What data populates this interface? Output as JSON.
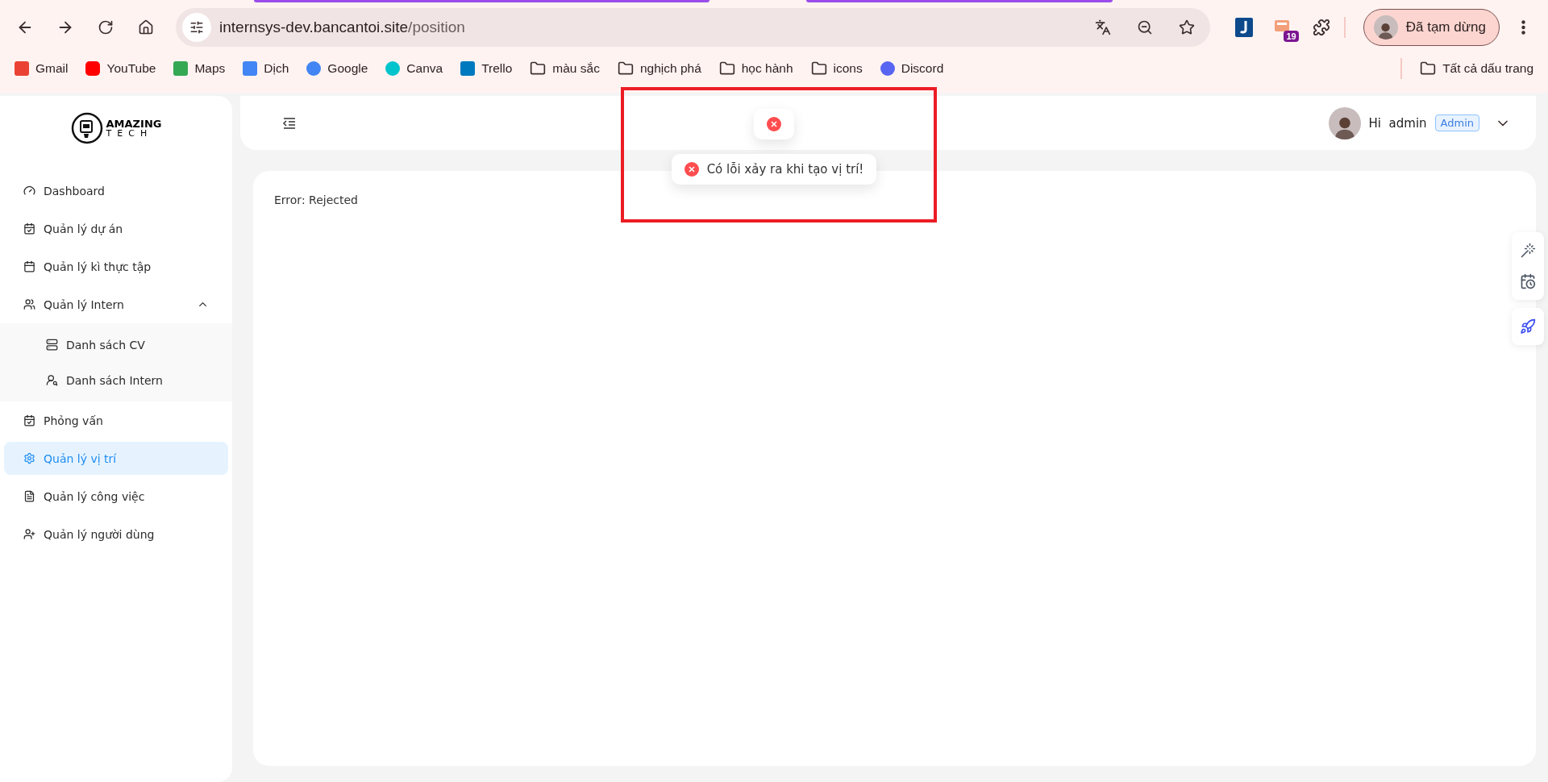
{
  "browser": {
    "url_host": "internsys-dev.bancantoi.site",
    "url_path": "/position",
    "extension_badge": "19",
    "profile_label": "Đã tạm dừng",
    "bookmarks": [
      {
        "kind": "site",
        "label": "Gmail"
      },
      {
        "kind": "site",
        "label": "YouTube"
      },
      {
        "kind": "site",
        "label": "Maps"
      },
      {
        "kind": "site",
        "label": "Dịch"
      },
      {
        "kind": "site",
        "label": "Google"
      },
      {
        "kind": "site",
        "label": "Canva"
      },
      {
        "kind": "site",
        "label": "Trello"
      },
      {
        "kind": "folder",
        "label": "màu sắc"
      },
      {
        "kind": "folder",
        "label": "nghịch phá"
      },
      {
        "kind": "folder",
        "label": "học hành"
      },
      {
        "kind": "folder",
        "label": "icons"
      },
      {
        "kind": "site",
        "label": "Discord"
      }
    ],
    "all_bookmarks": "Tất cả dấu trang"
  },
  "sidebar": {
    "logo_top": "AMAZING",
    "logo_bottom": "TECH",
    "items": [
      {
        "label": "Dashboard",
        "selected": false
      },
      {
        "label": "Quản lý dự án",
        "selected": false
      },
      {
        "label": "Quản lý kì thực tập",
        "selected": false
      },
      {
        "label": "Quản lý Intern",
        "selected": false,
        "expanded": true,
        "children": [
          {
            "label": "Danh sách CV",
            "selected": false
          },
          {
            "label": "Danh sách Intern",
            "selected": false
          }
        ]
      },
      {
        "label": "Phỏng vấn",
        "selected": false
      },
      {
        "label": "Quản lý vị trí",
        "selected": true
      },
      {
        "label": "Quản lý công việc",
        "selected": false
      },
      {
        "label": "Quản lý người dùng",
        "selected": false
      }
    ]
  },
  "header": {
    "greeting": "Hi",
    "user": "admin",
    "role": "Admin"
  },
  "toasts": [
    {
      "kind": "error"
    },
    {
      "kind": "error",
      "message": "Có lỗi xảy ra khi tạo vị trí!"
    }
  ],
  "content": {
    "message": "Error: Rejected"
  }
}
